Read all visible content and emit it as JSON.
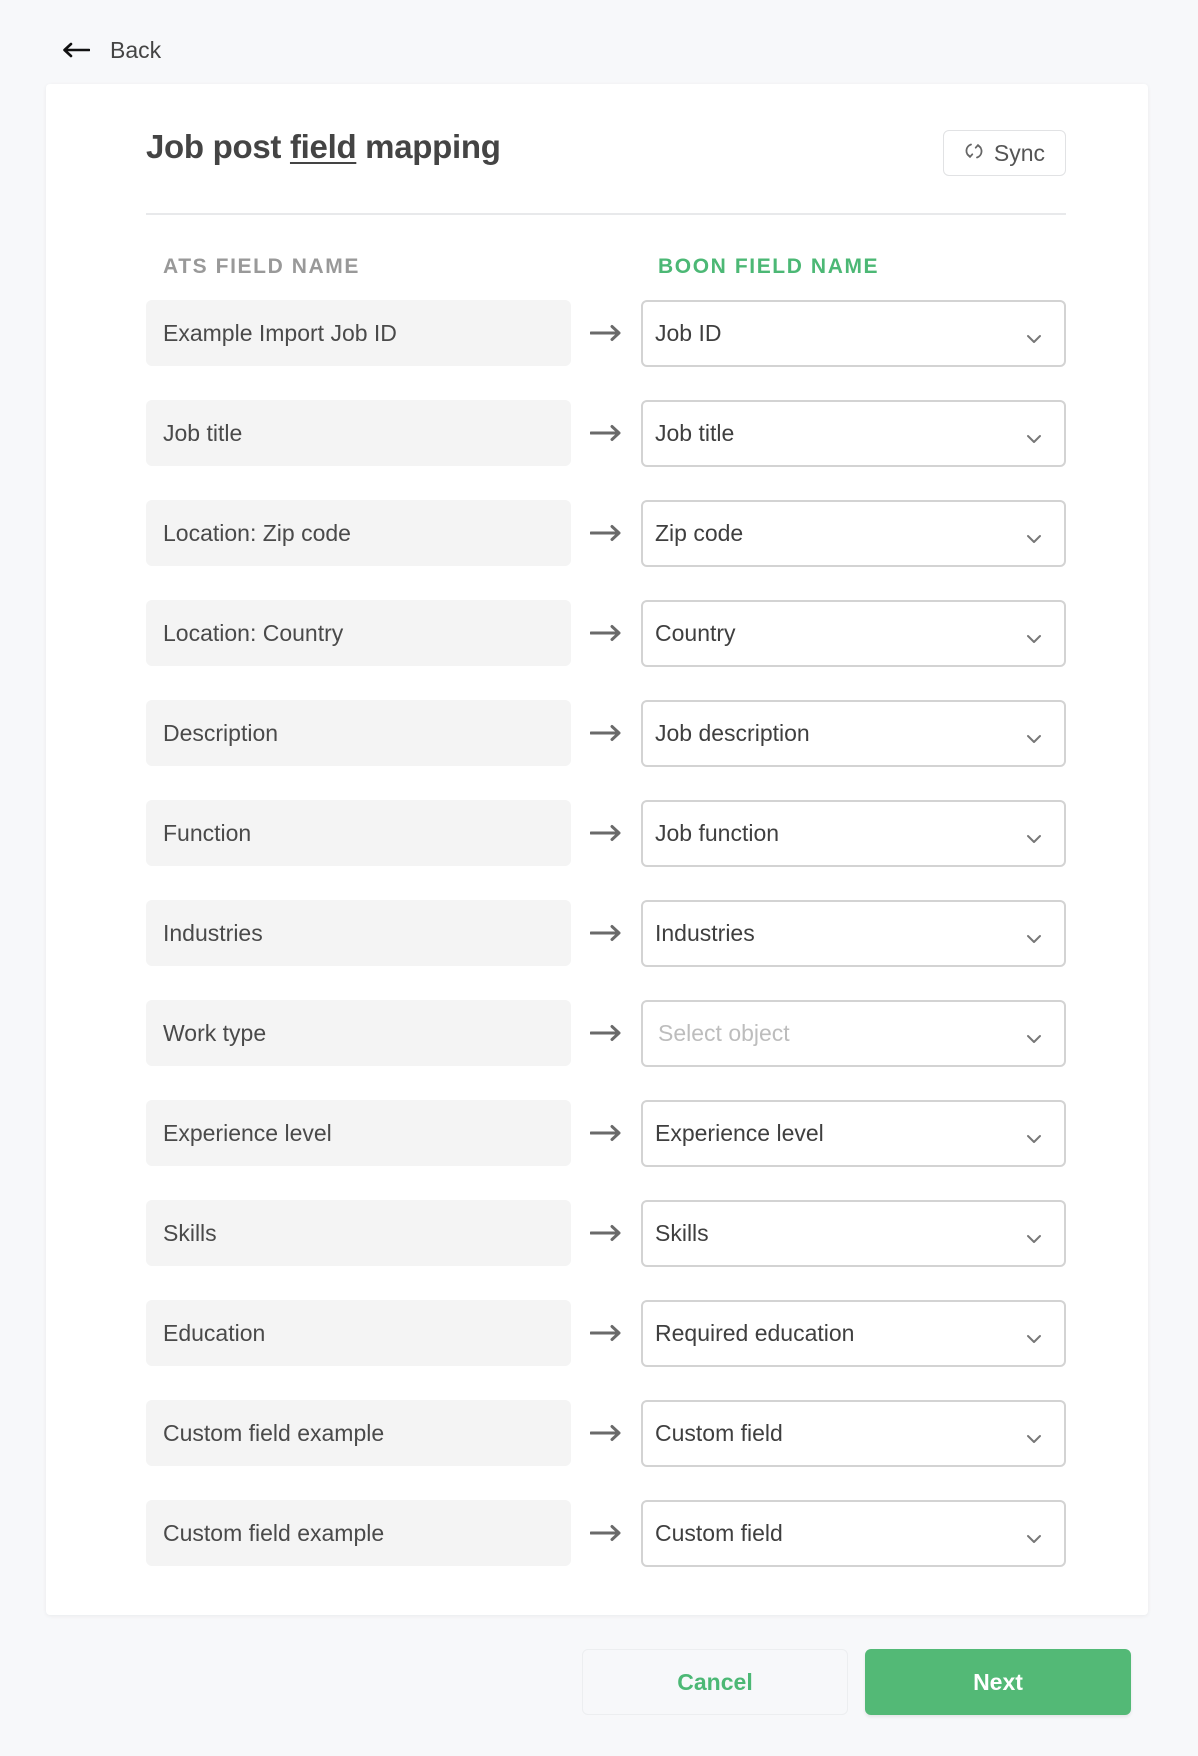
{
  "nav": {
    "back_label": "Back"
  },
  "header": {
    "title_before": "Job post ",
    "title_underlined": "field",
    "title_after": " mapping",
    "sync_label": "Sync"
  },
  "columns": {
    "ats_header": "ATS FIELD NAME",
    "boon_header": "BOON FIELD NAME"
  },
  "colors": {
    "accent": "#4cb875",
    "primary_button": "#53b976"
  },
  "mappings": [
    {
      "ats_field": "Example Import Job ID",
      "boon_field": "Job ID",
      "placeholder": "Select object"
    },
    {
      "ats_field": "Job title",
      "boon_field": "Job title",
      "placeholder": "Select object"
    },
    {
      "ats_field": "Location: Zip code",
      "boon_field": "Zip code",
      "placeholder": "Select object"
    },
    {
      "ats_field": "Location: Country",
      "boon_field": "Country",
      "placeholder": "Select object"
    },
    {
      "ats_field": "Description",
      "boon_field": "Job description",
      "placeholder": "Select object"
    },
    {
      "ats_field": "Function",
      "boon_field": "Job function",
      "placeholder": "Select object"
    },
    {
      "ats_field": "Industries",
      "boon_field": "Industries",
      "placeholder": "Select object"
    },
    {
      "ats_field": "Work type",
      "boon_field": "",
      "placeholder": "Select object"
    },
    {
      "ats_field": "Experience level",
      "boon_field": "Experience level",
      "placeholder": "Select object"
    },
    {
      "ats_field": "Skills",
      "boon_field": "Skills",
      "placeholder": "Select object"
    },
    {
      "ats_field": "Education",
      "boon_field": "Required education",
      "placeholder": "Select object"
    },
    {
      "ats_field": "Custom field example",
      "boon_field": "Custom field",
      "placeholder": "Select object"
    },
    {
      "ats_field": "Custom field example",
      "boon_field": "Custom field",
      "placeholder": "Select object"
    }
  ],
  "footer": {
    "cancel_label": "Cancel",
    "next_label": "Next"
  }
}
